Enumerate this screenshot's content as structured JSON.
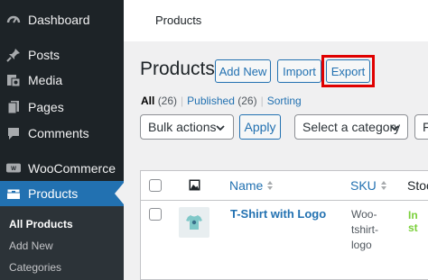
{
  "sidebar": {
    "items": [
      {
        "label": "Dashboard",
        "icon": "dashboard-icon"
      },
      {
        "label": "Posts",
        "icon": "pin-icon"
      },
      {
        "label": "Media",
        "icon": "media-icon"
      },
      {
        "label": "Pages",
        "icon": "pages-icon"
      },
      {
        "label": "Comments",
        "icon": "comments-icon"
      },
      {
        "label": "WooCommerce",
        "icon": "woo-icon"
      },
      {
        "label": "Products",
        "icon": "products-icon"
      }
    ],
    "submenu": [
      "All Products",
      "Add New",
      "Categories"
    ],
    "accent": "#2271b1"
  },
  "topbar": {
    "title": "Products"
  },
  "heading": {
    "title": "Products",
    "add_new": "Add New",
    "import": "Import",
    "export": "Export",
    "highlight_color": "#e00000"
  },
  "views": {
    "all": "All",
    "all_count": "(26)",
    "separator": "|",
    "published": "Published",
    "published_count": "(26)",
    "sorting": "Sorting"
  },
  "filters": {
    "bulk_actions": "Bulk actions",
    "apply": "Apply",
    "category": "Select a category",
    "next_partial": "F"
  },
  "table": {
    "columns": {
      "name": "Name",
      "sku": "SKU",
      "stock": "Stoc"
    },
    "rows": [
      {
        "name": "T-Shirt with Logo",
        "sku_lines": [
          "Woo-",
          "tshirt-",
          "logo"
        ],
        "stock": "In st"
      }
    ]
  }
}
